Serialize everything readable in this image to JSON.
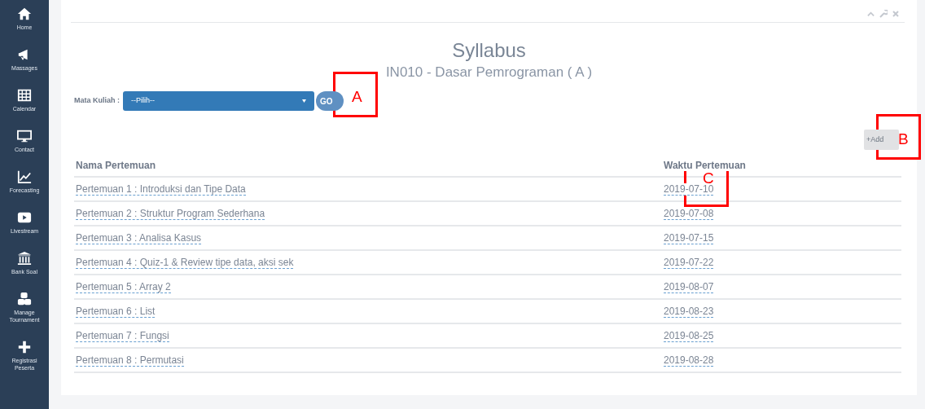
{
  "sidebar": {
    "items": [
      {
        "label": "Home"
      },
      {
        "label": "Massages"
      },
      {
        "label": "Calendar"
      },
      {
        "label": "Contact"
      },
      {
        "label": "Forecasting"
      },
      {
        "label": "Livestream"
      },
      {
        "label": "Bank Soal"
      },
      {
        "label": "Manage Tournament"
      },
      {
        "label": "Registrasi Peserta"
      }
    ]
  },
  "panel": {
    "title": "Syllabus",
    "subtitle": "IN010 - Dasar Pemrograman ( A )",
    "filter": {
      "label": "Mata Kuliah :",
      "select_value": "--Pilih--",
      "go_button": "GO"
    },
    "add_button": "+Add",
    "table": {
      "columns": [
        "Nama Pertemuan",
        "Waktu Pertemuan"
      ],
      "rows": [
        [
          "Pertemuan 1 : Introduksi dan Tipe Data",
          "2019-07-10"
        ],
        [
          "Pertemuan 2 : Struktur Program Sederhana",
          "2019-07-08"
        ],
        [
          "Pertemuan 3 : Analisa Kasus",
          "2019-07-15"
        ],
        [
          "Pertemuan 4 : Quiz-1 & Review tipe data, aksi sek",
          "2019-07-22"
        ],
        [
          "Pertemuan 5 : Array 2",
          "2019-08-07"
        ],
        [
          "Pertemuan 6 : List",
          "2019-08-23"
        ],
        [
          "Pertemuan 7 : Fungsi",
          "2019-08-25"
        ],
        [
          "Pertemuan 8 : Permutasi",
          "2019-08-28"
        ]
      ]
    }
  },
  "annotations": [
    {
      "label": "A"
    },
    {
      "label": "B"
    },
    {
      "label": "C"
    }
  ]
}
